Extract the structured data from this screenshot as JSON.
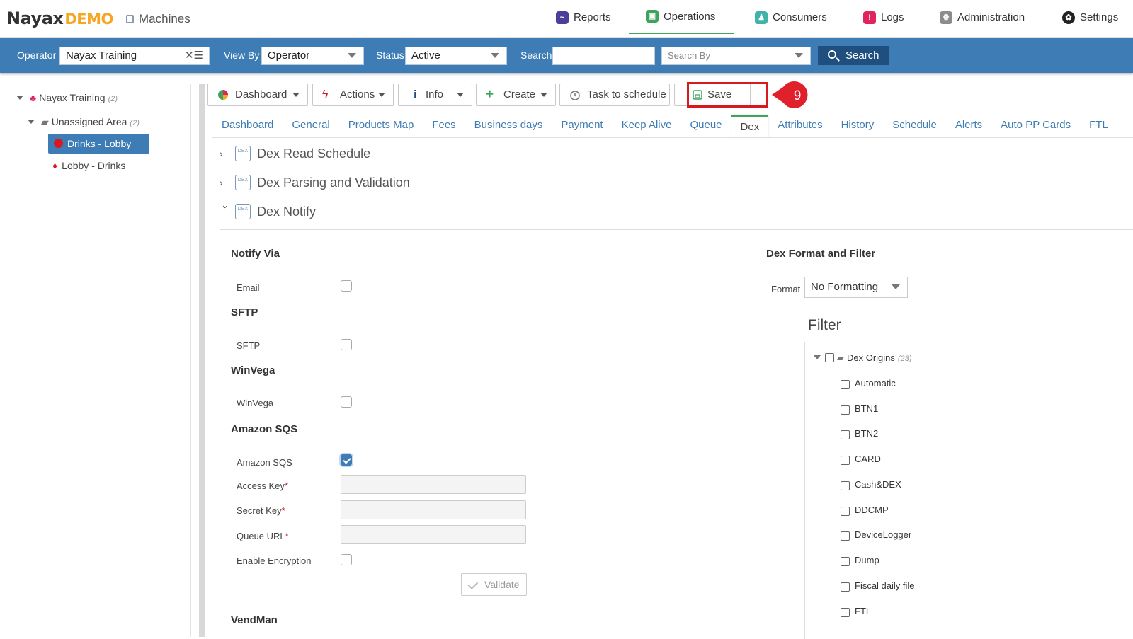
{
  "app": {
    "logo_main": "Nayax",
    "logo_demo": "DEMO",
    "section": "Machines"
  },
  "topnav": [
    {
      "label": "Reports",
      "icon": "reports-icon",
      "color": "#4b3f99"
    },
    {
      "label": "Operations",
      "icon": "operations-icon",
      "color": "#3da35d"
    },
    {
      "label": "Consumers",
      "icon": "consumers-icon",
      "color": "#3fb3a8"
    },
    {
      "label": "Logs",
      "icon": "logs-icon",
      "color": "#e0245e"
    },
    {
      "label": "Administration",
      "icon": "administration-icon",
      "color": "#8c8c8c"
    },
    {
      "label": "Settings",
      "icon": "settings-icon",
      "color": "#222222"
    }
  ],
  "filters": {
    "operator_label": "Operator",
    "operator_value": "Nayax Training",
    "viewby_label": "View By",
    "viewby_value": "Operator",
    "status_label": "Status",
    "status_value": "Active",
    "search_label": "Search",
    "search_value": "",
    "searchby_placeholder": "Search By",
    "search_button": "Search"
  },
  "tree": {
    "root": "Nayax Training",
    "root_count": "(2)",
    "area": "Unassigned Area",
    "area_count": "(2)",
    "item_selected": "Drinks - Lobby",
    "item_other": "Lobby - Drinks"
  },
  "actions": {
    "dashboard": "Dashboard",
    "actions": "Actions",
    "info": "Info",
    "create": "Create",
    "task": "Task to schedule",
    "save": "Save",
    "step_number": "9"
  },
  "tabs": [
    "Dashboard",
    "General",
    "Products Map",
    "Fees",
    "Business days",
    "Payment",
    "Keep Alive",
    "Queue",
    "Dex",
    "Attributes",
    "History",
    "Schedule",
    "Alerts",
    "Auto PP Cards",
    "FTL"
  ],
  "active_tab": "Dex",
  "sections": {
    "read_schedule": "Dex Read Schedule",
    "parsing": "Dex Parsing and Validation",
    "notify": "Dex Notify"
  },
  "notify": {
    "notify_via": "Notify Via",
    "email_label": "Email",
    "sftp_heading": "SFTP",
    "sftp_label": "SFTP",
    "winvega_heading": "WinVega",
    "winvega_label": "WinVega",
    "sqs_heading": "Amazon SQS",
    "sqs_label": "Amazon SQS",
    "access_key": "Access Key",
    "secret_key": "Secret Key",
    "queue_url": "Queue URL",
    "required_mark": "*",
    "enable_encryption": "Enable Encryption",
    "validate": "Validate",
    "vendman_heading": "VendMan"
  },
  "format": {
    "heading": "Dex Format and Filter",
    "format_label": "Format",
    "format_value": "No Formatting",
    "filter_title": "Filter",
    "origins_label": "Dex Origins",
    "origins_count": "(23)",
    "origins": [
      "Automatic",
      "BTN1",
      "BTN2",
      "CARD",
      "Cash&DEX",
      "DDCMP",
      "DeviceLogger",
      "Dump",
      "Fiscal daily file",
      "FTL"
    ]
  }
}
